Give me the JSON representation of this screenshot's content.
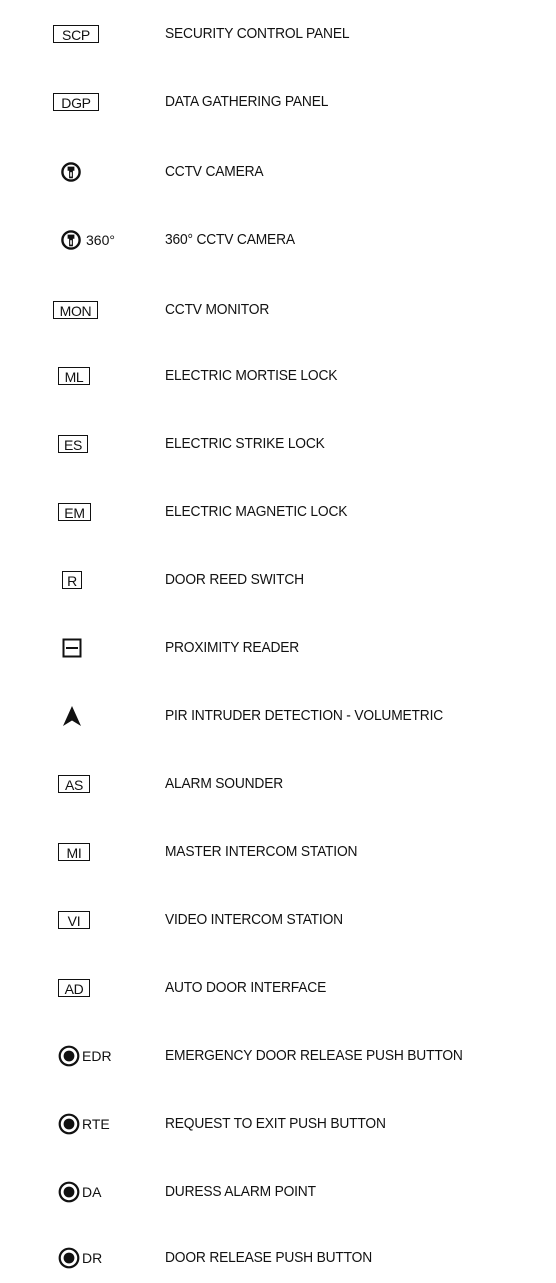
{
  "legend": {
    "items": [
      {
        "symbol": "SCP",
        "description": "SECURITY CONTROL PANEL"
      },
      {
        "symbol": "DGP",
        "description": "DATA GATHERING PANEL"
      },
      {
        "symbol": "",
        "description": "CCTV CAMERA",
        "icon": "cctv-camera-icon"
      },
      {
        "symbol": "360°",
        "description": "360° CCTV CAMERA",
        "icon": "cctv-camera-icon"
      },
      {
        "symbol": "MON",
        "description": "CCTV MONITOR"
      },
      {
        "symbol": "ML",
        "description": "ELECTRIC MORTISE LOCK"
      },
      {
        "symbol": "ES",
        "description": "ELECTRIC STRIKE LOCK"
      },
      {
        "symbol": "EM",
        "description": "ELECTRIC MAGNETIC LOCK"
      },
      {
        "symbol": "R",
        "description": "DOOR REED SWITCH"
      },
      {
        "symbol": "",
        "description": "PROXIMITY READER",
        "icon": "proximity-reader-icon"
      },
      {
        "symbol": "",
        "description": "PIR INTRUDER DETECTION - VOLUMETRIC",
        "icon": "pir-arrowhead-icon"
      },
      {
        "symbol": "AS",
        "description": "ALARM SOUNDER"
      },
      {
        "symbol": "MI",
        "description": "MASTER INTERCOM STATION"
      },
      {
        "symbol": "VI",
        "description": "VIDEO INTERCOM STATION"
      },
      {
        "symbol": "AD",
        "description": "AUTO DOOR INTERFACE"
      },
      {
        "symbol": "EDR",
        "description": "EMERGENCY DOOR RELEASE PUSH BUTTON",
        "icon": "push-button-icon"
      },
      {
        "symbol": "RTE",
        "description": "REQUEST TO EXIT PUSH BUTTON",
        "icon": "push-button-icon"
      },
      {
        "symbol": "DA",
        "description": "DURESS ALARM POINT",
        "icon": "push-button-icon"
      },
      {
        "symbol": "DR",
        "description": "DOOR RELEASE PUSH BUTTON",
        "icon": "push-button-icon"
      }
    ]
  }
}
